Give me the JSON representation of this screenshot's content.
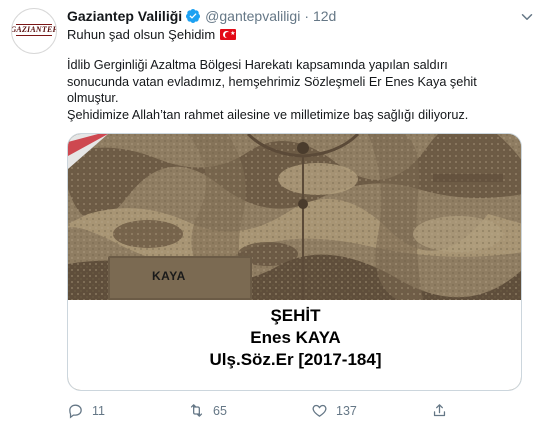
{
  "tweet": {
    "avatar_text": "GAZIANTEP",
    "display_name": "Gaziantep Valiliği",
    "handle": "@gantepvaliligi",
    "separator": "·",
    "time": "12d",
    "first_line": "Ruhun şad olsun Şehidim",
    "body": [
      "İdlib Gerginliği Azaltma Bölgesi Harekatı kapsamında yapılan saldırı",
      "sonucunda vatan evladımız, hemşehrimiz Sözleşmeli Er Enes Kaya şehit",
      "olmuştur.",
      "Şehidimize Allah’tan rahmet ailesine ve milletimize baş sağlığı diliyoruz."
    ],
    "image": {
      "name_tape": "KAYA",
      "caption_line1": "ŞEHİT",
      "caption_line2": "Enes KAYA",
      "caption_line3": "Ulş.Söz.Er [2017-184]"
    },
    "actions": {
      "replies": "11",
      "retweets": "65",
      "likes": "137"
    },
    "colors": {
      "text": "#14171a",
      "secondary": "#657786",
      "verified": "#1da1f2",
      "flag": "#e30a17"
    },
    "icons": [
      "verified-badge-icon",
      "chevron-down-icon",
      "turkish-flag-icon",
      "reply-icon",
      "retweet-icon",
      "like-icon",
      "share-icon"
    ]
  }
}
